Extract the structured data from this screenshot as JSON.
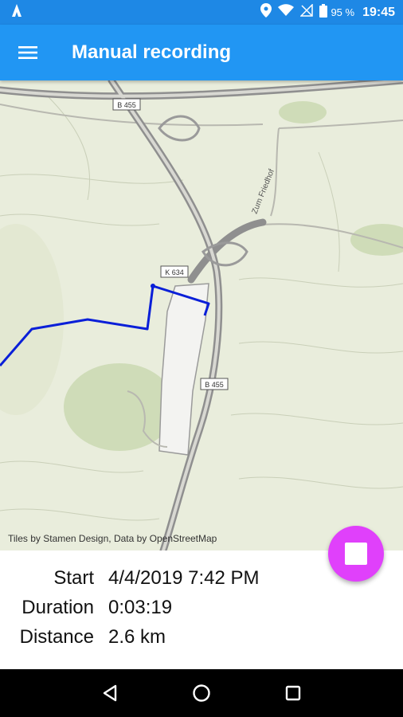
{
  "status_bar": {
    "battery_percent": "95 %",
    "time": "19:45"
  },
  "app_bar": {
    "title": "Manual recording"
  },
  "map": {
    "road_labels": [
      "B 455",
      "K 634",
      "B 455"
    ],
    "street_label": "Zum Friedhof",
    "attribution": "Tiles by Stamen Design, Data by OpenStreetMap",
    "track_color": "#0a1fd8"
  },
  "recording": {
    "start_label": "Start",
    "start_value": "4/4/2019 7:42 PM",
    "duration_label": "Duration",
    "duration_value": "0:03:19",
    "distance_label": "Distance",
    "distance_value": "2.6 km"
  },
  "fab": {
    "icon": "stop-icon",
    "color": "#e040fb"
  },
  "nav_bar": {
    "icons": [
      "back-icon",
      "home-icon",
      "recents-icon"
    ]
  }
}
